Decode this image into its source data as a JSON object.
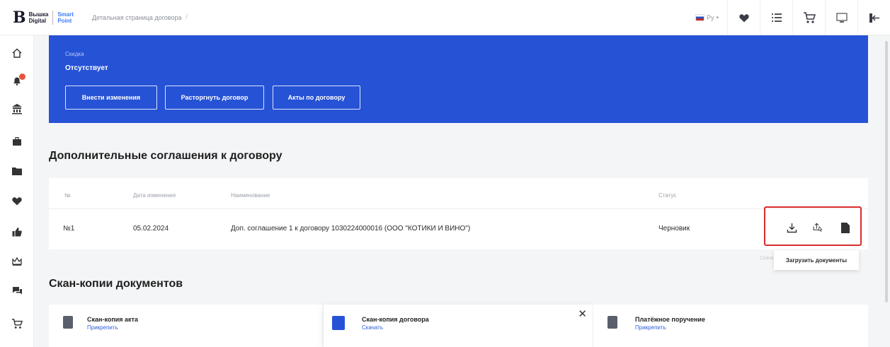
{
  "header": {
    "logo_main_line1": "Вышка",
    "logo_main_line2": "Digital",
    "logo_sub_line1": "Smart",
    "logo_sub_line2": "Point",
    "breadcrumb": "Детальная страница договора",
    "language": "Ру"
  },
  "blue_card": {
    "discount_label": "Скидка",
    "discount_value": "Отсутствует",
    "buttons": [
      "Внести изменения",
      "Расторгнуть договор",
      "Акты по договору"
    ]
  },
  "agreements": {
    "title": "Дополнительные соглашения к договору",
    "columns": [
      "№",
      "Дата изменения",
      "Наименование",
      "Статус"
    ],
    "rows": [
      {
        "num": "№1",
        "date": "05.02.2024",
        "name": "Доп. соглашение 1 к договору 1030224000016 (ООО \"КОТИКИ И ВИНО\")",
        "status": "Черновик"
      }
    ],
    "tooltip_faint": "Скача",
    "tooltip": "Загрузить документы"
  },
  "scans": {
    "title": "Скан-копии документов",
    "cards": [
      {
        "title": "Скан-копия акта",
        "link": "Прикрепить"
      },
      {
        "title": "Скан-копия договора",
        "link": "Скачать"
      },
      {
        "title": "Платёжное поручение",
        "link": "Прикрепить"
      }
    ]
  },
  "colors": {
    "accent": "#2652d6",
    "highlight": "#d92b2b"
  }
}
